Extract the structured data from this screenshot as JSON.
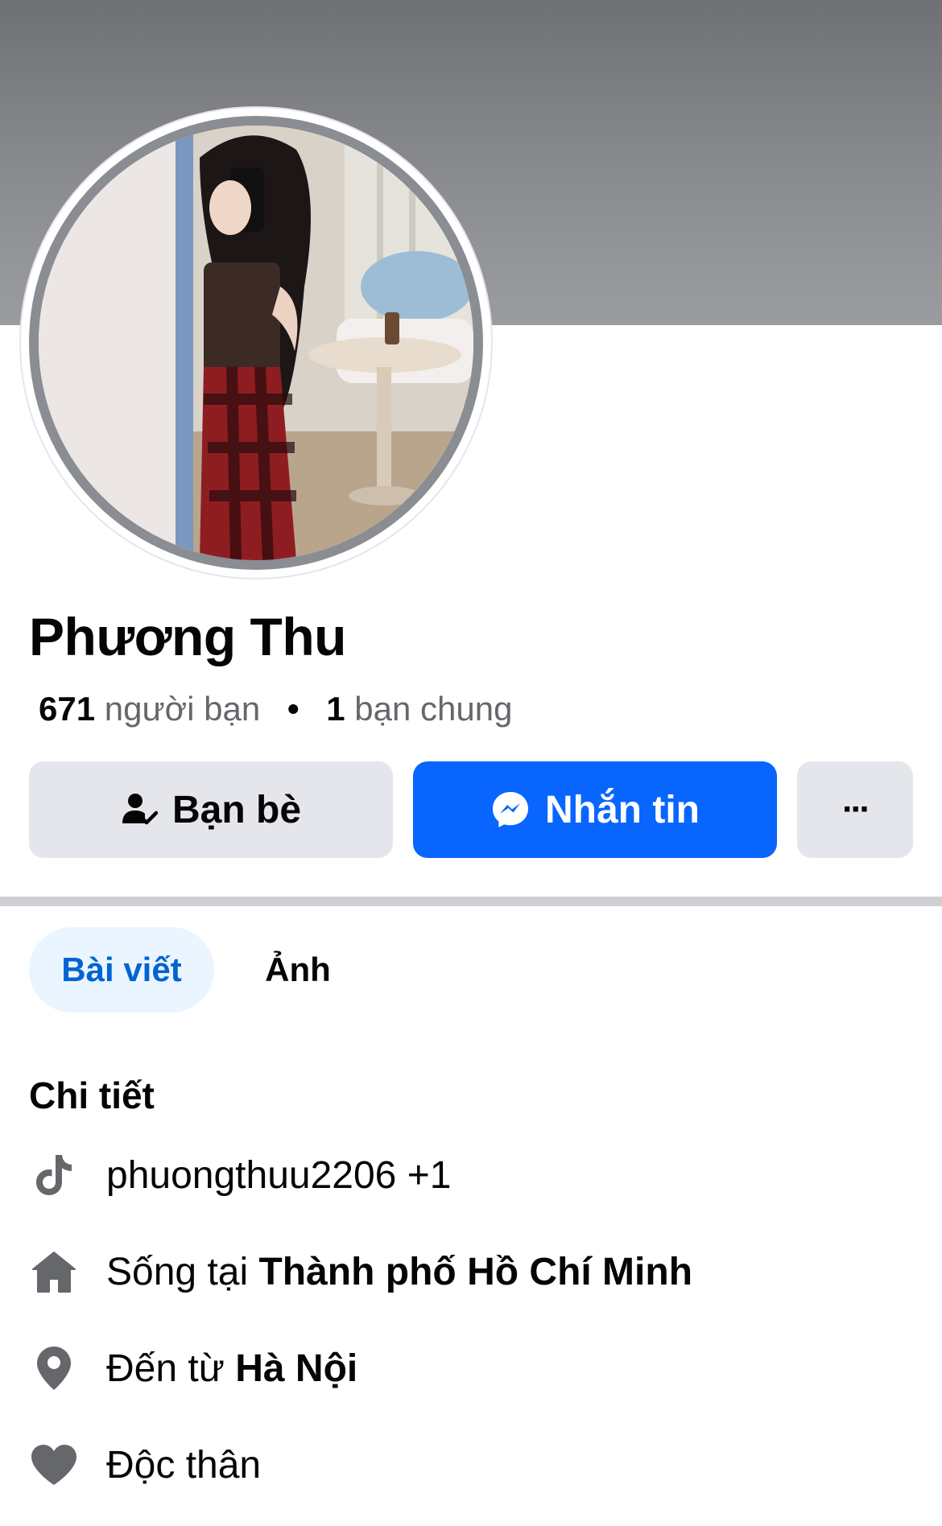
{
  "profile": {
    "name": "Phương Thu",
    "friends_count": "671",
    "friends_label": "người bạn",
    "separator": "•",
    "mutual_count": "1",
    "mutual_label": "bạn chung"
  },
  "actions": {
    "friends_button": "Bạn bè",
    "message_button": "Nhắn tin",
    "more_button": "···"
  },
  "tabs": [
    {
      "label": "Bài viết",
      "active": true
    },
    {
      "label": "Ảnh",
      "active": false
    }
  ],
  "details": {
    "title": "Chi tiết",
    "items": [
      {
        "icon": "tiktok-icon",
        "text": "phuongthuu2206 +1"
      },
      {
        "icon": "home-icon",
        "prefix": "Sống tại ",
        "value": "Thành phố Hồ Chí Minh"
      },
      {
        "icon": "location-pin-icon",
        "prefix": "Đến từ ",
        "value": "Hà Nội"
      },
      {
        "icon": "heart-icon",
        "text": "Độc thân"
      }
    ]
  },
  "colors": {
    "accent": "#0866ff",
    "active_tab_bg": "#ebf5ff",
    "active_tab_text": "#0064d1",
    "button_gray": "#e4e6eb",
    "secondary_text": "#65676b"
  }
}
